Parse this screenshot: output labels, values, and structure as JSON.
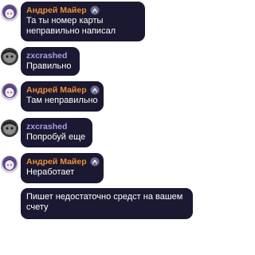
{
  "chat": {
    "messages": [
      {
        "author": "Андрей Майер",
        "text": "Та ты номер карты неправильно написал"
      },
      {
        "author": "zxcrashed",
        "text": "Правильно"
      },
      {
        "author": "Андрей Майер",
        "text": "Там неправильно"
      },
      {
        "author": "zxcrashed",
        "text": "Попробуй еще"
      },
      {
        "author": "Андрей Майер",
        "text": "Неработает"
      },
      {
        "author": "",
        "text": "Пишет недостаточно средст на вашем счету"
      }
    ]
  },
  "colors": {
    "bubble": "#1b1931",
    "andrey_name": "#ee8f34",
    "zx_name": "#a99ce8",
    "text": "#ffffff"
  },
  "icons": {
    "andrey_avatar": "anime-girl-avatar-icon",
    "zx_avatar": "grayscale-avatar-icon",
    "badge": "admin-badge-icon"
  }
}
